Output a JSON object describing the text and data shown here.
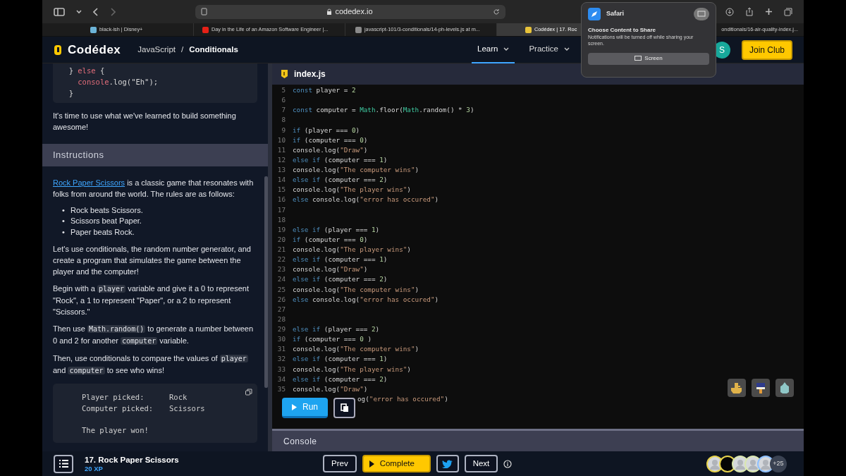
{
  "browser": {
    "url": "codedex.io",
    "tabs": [
      {
        "title": "black-ish | Disney+",
        "selected": false
      },
      {
        "title": "Day in the Life of an Amazon Software Engineer |...",
        "selected": false
      },
      {
        "title": "javascript-101/3-conditionals/14-ph-levels.js at m...",
        "selected": false
      },
      {
        "title": "Codédex | 17. Roc",
        "selected": true
      },
      {
        "title": "onditionals/16-air-quality-index.j...",
        "selected": false
      }
    ]
  },
  "share_popup": {
    "app": "Safari",
    "heading": "Choose Content to Share",
    "note": "Notifications will be turned off while sharing your screen.",
    "button": "Screen"
  },
  "site_nav": {
    "brand": "Codédex",
    "breadcrumb": [
      "JavaScript",
      "Conditionals"
    ],
    "separator": "/",
    "items": [
      {
        "label": "Learn",
        "selected": true
      },
      {
        "label": "Practice",
        "selected": false
      }
    ],
    "avatar": "S",
    "join": "Join Club"
  },
  "lesson": {
    "snippet": [
      {
        "kind": "outer",
        "t": [
          {
            "kind": "plain",
            "text": "} "
          },
          {
            "kind": "red",
            "text": "else"
          },
          {
            "kind": "plain",
            "text": " {"
          }
        ]
      },
      {
        "kind": "inner",
        "t": [
          {
            "kind": "red",
            "text": "console"
          },
          {
            "kind": "plain",
            "text": ".log(\"Eh\");"
          }
        ]
      },
      {
        "kind": "outer",
        "t": [
          {
            "kind": "plain",
            "text": "}"
          }
        ]
      }
    ],
    "intro": "It's time to use what we've learned to build something awesome!",
    "section": "Instructions",
    "paragraphs": [
      [
        {
          "kind": "link",
          "text": "Rock Paper Scissors"
        },
        {
          "kind": "text",
          "text": " is a classic game that resonates with folks from around the world. The rules are as follows:"
        }
      ],
      [
        {
          "kind": "list",
          "items": [
            {
              "marker": "•",
              "text": "Rock beats Scissors."
            },
            {
              "marker": "•",
              "text": "Scissors beat Paper."
            },
            {
              "marker": "•",
              "text": "Paper beats Rock."
            }
          ]
        }
      ],
      [
        {
          "kind": "text",
          "text": "Let's use conditionals, the random number generator, and create a program that simulates the game between the player and the computer!"
        }
      ],
      [
        {
          "kind": "text",
          "text": "Begin with a "
        },
        {
          "kind": "code",
          "text": "player"
        },
        {
          "kind": "text",
          "text": " variable and give it a 0 to represent \"Rock\", a 1 to represent \"Paper\", or a 2 to represent \"Scissors.\""
        }
      ],
      [
        {
          "kind": "text",
          "text": "Then use "
        },
        {
          "kind": "code",
          "text": "Math.random()"
        },
        {
          "kind": "text",
          "text": " to generate a number between 0 and 2 for another "
        },
        {
          "kind": "code",
          "text": "computer"
        },
        {
          "kind": "text",
          "text": " variable."
        }
      ],
      [
        {
          "kind": "text",
          "text": "Then, use conditionals to compare the values of "
        },
        {
          "kind": "code",
          "text": "player"
        },
        {
          "kind": "text",
          "text": " and "
        },
        {
          "kind": "code",
          "text": "computer"
        },
        {
          "kind": "text",
          "text": " to see who wins!"
        }
      ]
    ],
    "output": {
      "rows": [
        [
          "Player picked:",
          "Rock"
        ],
        [
          "Computer picked:",
          "Scissors"
        ]
      ],
      "result": "The player won!"
    }
  },
  "editor": {
    "file": "index.js",
    "lines": [
      {
        "n": "5",
        "t": [
          {
            "kind": "keyword",
            "text": "const"
          },
          {
            "kind": "plain",
            "text": " player = "
          },
          {
            "kind": "number",
            "text": "2"
          }
        ]
      },
      {
        "n": "6"
      },
      {
        "n": "7",
        "t": [
          {
            "kind": "keyword",
            "text": "const"
          },
          {
            "kind": "plain",
            "text": " computer = "
          },
          {
            "kind": "builtin",
            "text": "Math"
          },
          {
            "kind": "plain",
            "text": ".floor("
          },
          {
            "kind": "builtin",
            "text": "Math"
          },
          {
            "kind": "plain",
            "text": ".random() * "
          },
          {
            "kind": "number",
            "text": "3"
          },
          {
            "kind": "plain",
            "text": ")"
          }
        ]
      },
      {
        "n": "8"
      },
      {
        "n": "9",
        "t": [
          {
            "kind": "keyword",
            "text": "if"
          },
          {
            "kind": "plain",
            "text": " (player === "
          },
          {
            "kind": "number",
            "text": "0"
          },
          {
            "kind": "plain",
            "text": ")"
          }
        ]
      },
      {
        "n": "10",
        "t": [
          {
            "kind": "keyword",
            "text": "if"
          },
          {
            "kind": "plain",
            "text": " (computer === "
          },
          {
            "kind": "number",
            "text": "0"
          },
          {
            "kind": "plain",
            "text": ")"
          }
        ]
      },
      {
        "n": "11",
        "t": [
          {
            "kind": "plain",
            "text": "console.log("
          },
          {
            "kind": "string",
            "text": "\"Draw\""
          },
          {
            "kind": "plain",
            "text": ")"
          }
        ]
      },
      {
        "n": "12",
        "t": [
          {
            "kind": "keyword",
            "text": "else if"
          },
          {
            "kind": "plain",
            "text": " (computer === "
          },
          {
            "kind": "number",
            "text": "1"
          },
          {
            "kind": "plain",
            "text": ")"
          }
        ]
      },
      {
        "n": "13",
        "t": [
          {
            "kind": "plain",
            "text": "console.log("
          },
          {
            "kind": "string",
            "text": "\"The computer wins\""
          },
          {
            "kind": "plain",
            "text": ")"
          }
        ]
      },
      {
        "n": "14",
        "t": [
          {
            "kind": "keyword",
            "text": "else if"
          },
          {
            "kind": "plain",
            "text": " (computer === "
          },
          {
            "kind": "number",
            "text": "2"
          },
          {
            "kind": "plain",
            "text": ")"
          }
        ]
      },
      {
        "n": "15",
        "t": [
          {
            "kind": "plain",
            "text": "console.log("
          },
          {
            "kind": "string",
            "text": "\"The player wins\""
          },
          {
            "kind": "plain",
            "text": ")"
          }
        ]
      },
      {
        "n": "16",
        "t": [
          {
            "kind": "keyword",
            "text": "else"
          },
          {
            "kind": "plain",
            "text": " console.log("
          },
          {
            "kind": "string",
            "text": "\"error has occured\""
          },
          {
            "kind": "plain",
            "text": ")"
          }
        ]
      },
      {
        "n": "17"
      },
      {
        "n": "18"
      },
      {
        "n": "19",
        "t": [
          {
            "kind": "keyword",
            "text": "else if"
          },
          {
            "kind": "plain",
            "text": " (player === "
          },
          {
            "kind": "number",
            "text": "1"
          },
          {
            "kind": "plain",
            "text": ")"
          }
        ]
      },
      {
        "n": "20",
        "t": [
          {
            "kind": "keyword",
            "text": "if"
          },
          {
            "kind": "plain",
            "text": " (computer === "
          },
          {
            "kind": "number",
            "text": "0"
          },
          {
            "kind": "plain",
            "text": ")"
          }
        ]
      },
      {
        "n": "21",
        "t": [
          {
            "kind": "plain",
            "text": "console.log("
          },
          {
            "kind": "string",
            "text": "\"The player wins\""
          },
          {
            "kind": "plain",
            "text": ")"
          }
        ]
      },
      {
        "n": "22",
        "t": [
          {
            "kind": "keyword",
            "text": "else if"
          },
          {
            "kind": "plain",
            "text": " (computer === "
          },
          {
            "kind": "number",
            "text": "1"
          },
          {
            "kind": "plain",
            "text": ")"
          }
        ]
      },
      {
        "n": "23",
        "t": [
          {
            "kind": "plain",
            "text": "console.log("
          },
          {
            "kind": "string",
            "text": "\"Draw\""
          },
          {
            "kind": "plain",
            "text": ")"
          }
        ]
      },
      {
        "n": "24",
        "t": [
          {
            "kind": "keyword",
            "text": "else if"
          },
          {
            "kind": "plain",
            "text": " (computer === "
          },
          {
            "kind": "number",
            "text": "2"
          },
          {
            "kind": "plain",
            "text": ")"
          }
        ]
      },
      {
        "n": "25",
        "t": [
          {
            "kind": "plain",
            "text": "console.log("
          },
          {
            "kind": "string",
            "text": "\"The computer wins\""
          },
          {
            "kind": "plain",
            "text": ")"
          }
        ]
      },
      {
        "n": "26",
        "t": [
          {
            "kind": "keyword",
            "text": "else"
          },
          {
            "kind": "plain",
            "text": " console.log("
          },
          {
            "kind": "string",
            "text": "\"error has occured\""
          },
          {
            "kind": "plain",
            "text": ")"
          }
        ]
      },
      {
        "n": "27"
      },
      {
        "n": "28"
      },
      {
        "n": "29",
        "t": [
          {
            "kind": "keyword",
            "text": "else if"
          },
          {
            "kind": "plain",
            "text": " (player === "
          },
          {
            "kind": "number",
            "text": "2"
          },
          {
            "kind": "plain",
            "text": ")"
          }
        ]
      },
      {
        "n": "30",
        "t": [
          {
            "kind": "keyword",
            "text": "if"
          },
          {
            "kind": "plain",
            "text": " (computer === "
          },
          {
            "kind": "number",
            "text": "0"
          },
          {
            "kind": "plain",
            "text": " )"
          }
        ]
      },
      {
        "n": "31",
        "t": [
          {
            "kind": "plain",
            "text": "console.log("
          },
          {
            "kind": "string",
            "text": "\"The computer wins\""
          },
          {
            "kind": "plain",
            "text": ")"
          }
        ]
      },
      {
        "n": "32",
        "t": [
          {
            "kind": "keyword",
            "text": "else if"
          },
          {
            "kind": "plain",
            "text": " (computer === "
          },
          {
            "kind": "number",
            "text": "1"
          },
          {
            "kind": "plain",
            "text": ")"
          }
        ]
      },
      {
        "n": "33",
        "t": [
          {
            "kind": "plain",
            "text": "console.log("
          },
          {
            "kind": "string",
            "text": "\"The player wins\""
          },
          {
            "kind": "plain",
            "text": ")"
          }
        ]
      },
      {
        "n": "34",
        "t": [
          {
            "kind": "keyword",
            "text": "else if"
          },
          {
            "kind": "plain",
            "text": " (computer === "
          },
          {
            "kind": "number",
            "text": "2"
          },
          {
            "kind": "plain",
            "text": ")"
          }
        ]
      },
      {
        "n": "35",
        "t": [
          {
            "kind": "plain",
            "text": "console.log("
          },
          {
            "kind": "string",
            "text": "\"Draw\""
          },
          {
            "kind": "plain",
            "text": ")"
          }
        ]
      },
      {
        "kind": "covered",
        "t": [
          {
            "kind": "plain",
            "text": "og("
          },
          {
            "kind": "string",
            "text": "\"error has occured\""
          },
          {
            "kind": "plain",
            "text": ")"
          }
        ]
      }
    ],
    "run": "Run",
    "console": "Console"
  },
  "footer": {
    "title": "17. Rock Paper Scissors",
    "xp": "20 XP",
    "prev": "Prev",
    "complete": "Complete",
    "next": "Next",
    "more_learners": "+25"
  }
}
